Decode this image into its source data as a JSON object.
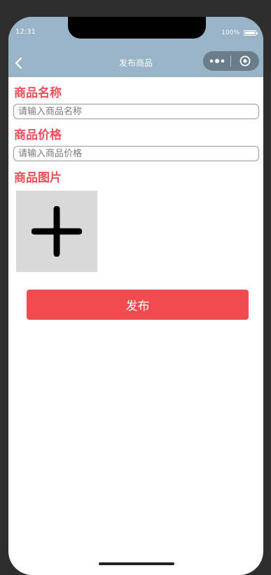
{
  "status_bar": {
    "time": "12:31",
    "battery_text": "100%"
  },
  "navbar": {
    "title": "发布商品"
  },
  "form": {
    "name_label": "商品名称",
    "name_placeholder": "请输入商品名称",
    "price_label": "商品价格",
    "price_placeholder": "请输入商品价格",
    "image_label": "商品图片",
    "submit_label": "发布"
  },
  "colors": {
    "accent": "#f24b4f",
    "navbar_bg": "#99b3c7",
    "image_placeholder_bg": "#d9d9d9"
  }
}
